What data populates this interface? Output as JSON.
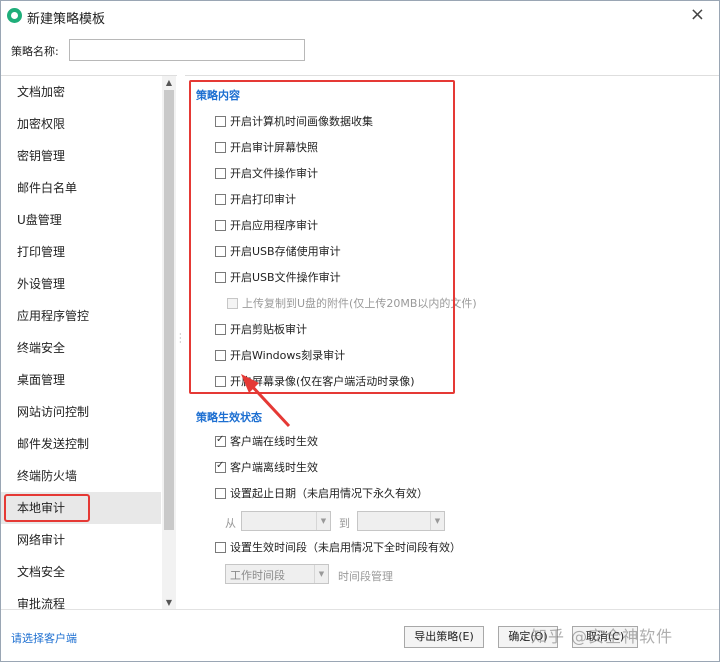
{
  "window": {
    "title": "新建策略模板",
    "close": "×"
  },
  "name_row": {
    "label": "策略名称:",
    "value": ""
  },
  "nav": {
    "items": [
      "文档加密",
      "加密权限",
      "密钥管理",
      "邮件白名单",
      "U盘管理",
      "打印管理",
      "外设管理",
      "应用程序管控",
      "终端安全",
      "桌面管理",
      "网站访问控制",
      "邮件发送控制",
      "终端防火墙",
      "本地审计",
      "网络审计",
      "文档安全",
      "审批流程"
    ],
    "active_index": 13
  },
  "policy_content": {
    "title": "策略内容",
    "items": [
      {
        "label": "开启计算机时间画像数据收集",
        "checked": false
      },
      {
        "label": "开启审计屏幕快照",
        "checked": false
      },
      {
        "label": "开启文件操作审计",
        "checked": false
      },
      {
        "label": "开启打印审计",
        "checked": false
      },
      {
        "label": "开启应用程序审计",
        "checked": false
      },
      {
        "label": "开启USB存储使用审计",
        "checked": false
      },
      {
        "label": "开启USB文件操作审计",
        "checked": false
      },
      {
        "label": "上传复制到U盘的附件(仅上传20MB以内的文件)",
        "checked": false,
        "disabled": true
      },
      {
        "label": "开启剪贴板审计",
        "checked": false
      },
      {
        "label": "开启Windows刻录审计",
        "checked": false
      },
      {
        "label": "开启屏幕录像(仅在客户端活动时录像)",
        "checked": false
      }
    ]
  },
  "effective_state": {
    "title": "策略生效状态",
    "online": {
      "label": "客户端在线时生效",
      "checked": true
    },
    "offline": {
      "label": "客户端离线时生效",
      "checked": true
    },
    "date_range": {
      "label": "设置起止日期（未启用情况下永久有效）",
      "checked": false,
      "from_label": "从",
      "to_label": "到"
    },
    "time_range": {
      "label": "设置生效时间段（未启用情况下全时间段有效）",
      "checked": false,
      "select_value": "工作时间段",
      "manage_label": "时间段管理"
    }
  },
  "footer": {
    "select_client": "请选择客户端",
    "export": "导出策略(E)",
    "ok": "确定(O)",
    "cancel": "取消(C)"
  },
  "watermark": "知乎 @安全神软件",
  "colors": {
    "accent": "#1d6fd1",
    "highlight": "#e53935"
  }
}
